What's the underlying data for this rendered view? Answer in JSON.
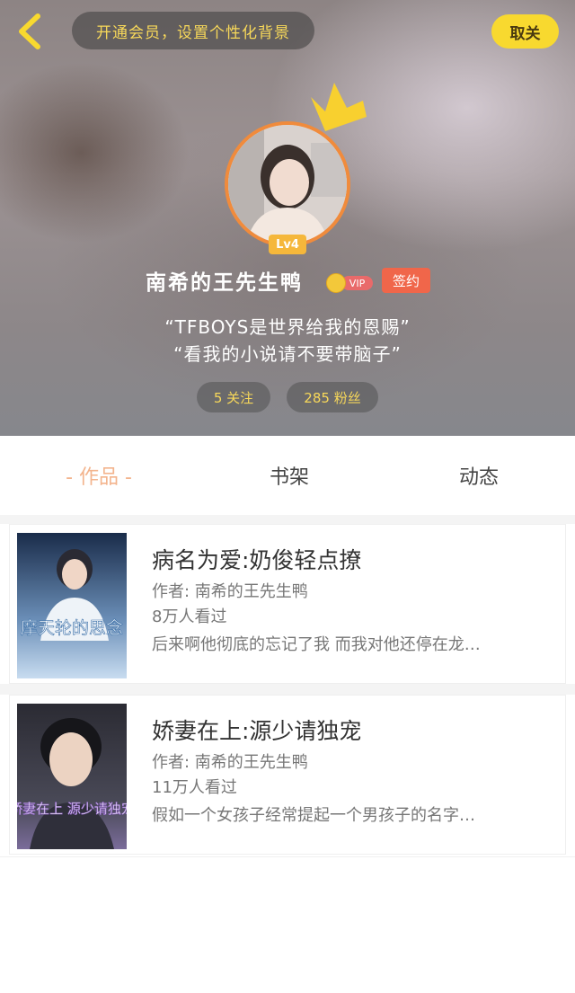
{
  "header": {
    "vip_banner": "开通会员，设置个性化背景",
    "unfollow_label": "取关"
  },
  "profile": {
    "level": "Lv4",
    "username": "南希的王先生鸭",
    "vip_label": "VIP",
    "signed_label": "签约",
    "bio_line1": "“TFBOYS是世界给我的恩赐”",
    "bio_line2": "“看我的小说请不要带脑子”",
    "following": "5 关注",
    "fans": "285 粉丝"
  },
  "tabs": {
    "works": "- 作品 -",
    "shelf": "书架",
    "feed": "动态"
  },
  "books": [
    {
      "title": "病名为爱:奶俊轻点撩",
      "author": "作者: 南希的王先生鸭",
      "views": "8万人看过",
      "desc": "后来啊他彻底的忘记了我 而我对他还停在龙…",
      "cover_text": "摩天轮的思念"
    },
    {
      "title": "娇妻在上:源少请独宠",
      "author": "作者: 南希的王先生鸭",
      "views": "11万人看过",
      "desc": "假如一个女孩子经常提起一个男孩子的名字…",
      "cover_text": "娇妻在上 源少请独宠"
    }
  ],
  "colors": {
    "accent_yellow": "#f8d92f",
    "avatar_ring": "#f08b3c",
    "signed": "#f0664a",
    "active_tab": "#f3b48d"
  }
}
